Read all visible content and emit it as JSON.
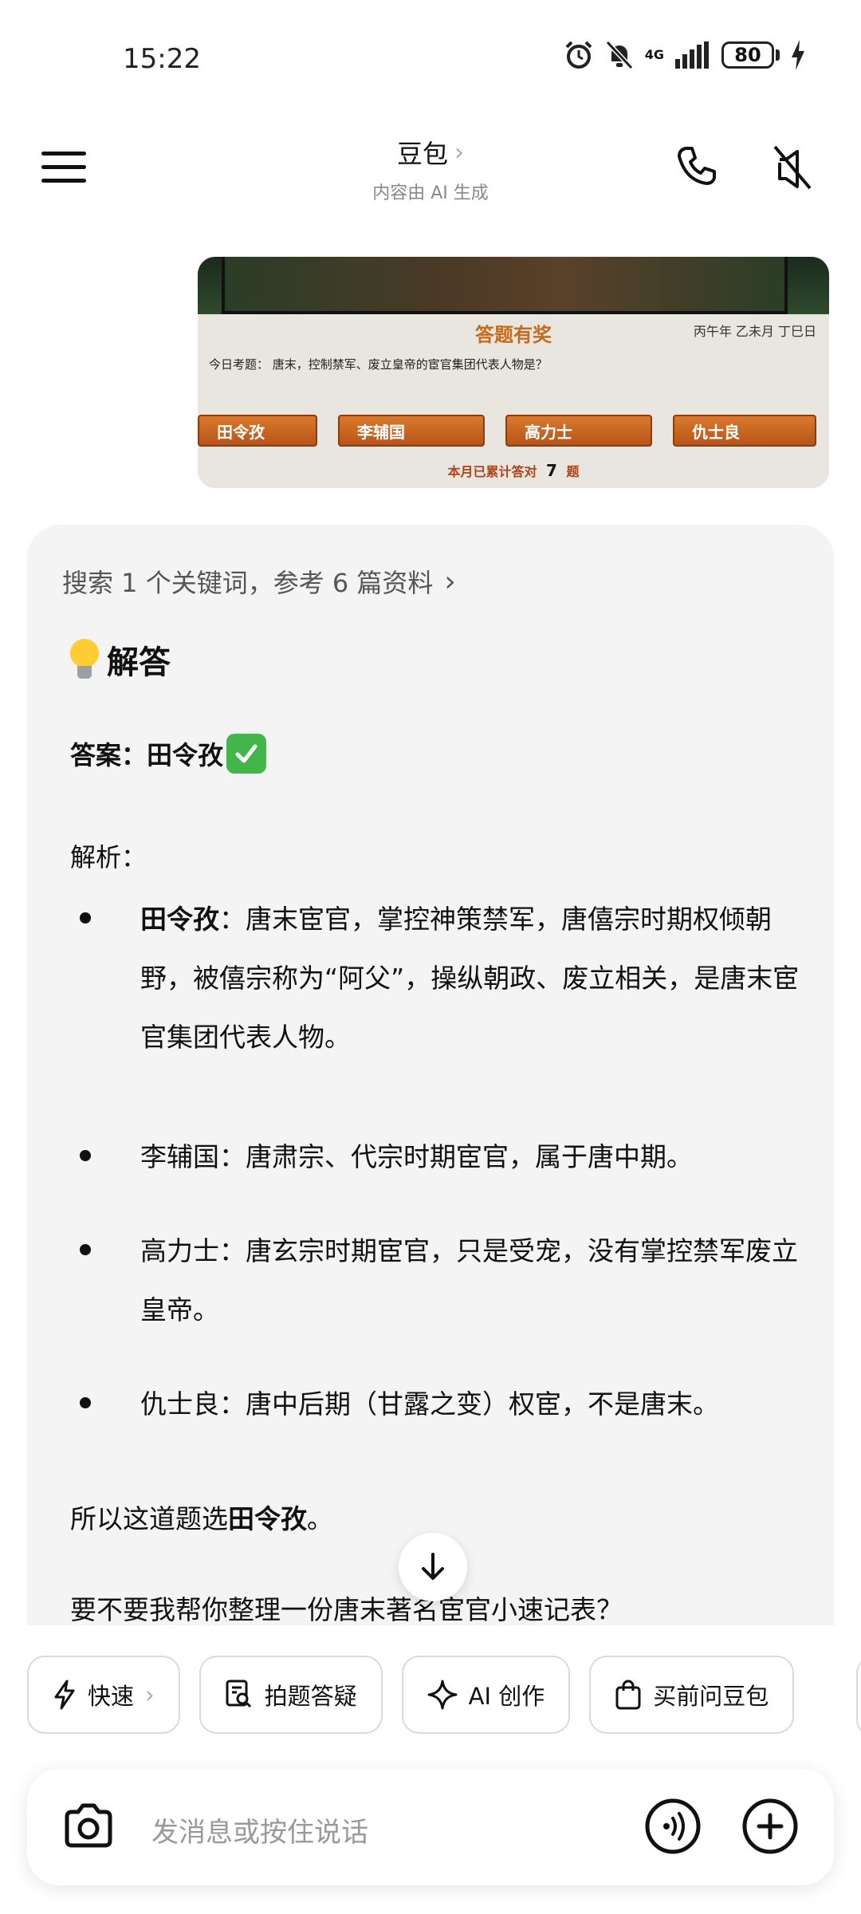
{
  "status_bar": {
    "time": "15:22",
    "network": "4G",
    "battery": "80"
  },
  "header": {
    "title": "豆包",
    "subtitle": "内容由 AI 生成"
  },
  "image_message": {
    "quiz_title": "答题有奖",
    "quiz_date": "丙午年 乙未月 丁巳日",
    "quiz_question": "今日考题： 唐末，控制禁军、废立皇帝的宦官集团代表人物是？",
    "options": [
      "田令孜",
      "李辅国",
      "高力士",
      "仇士良"
    ],
    "quiz_count_prefix": "本月已累计答对",
    "quiz_count_value": "7",
    "quiz_count_suffix": "题"
  },
  "answer": {
    "search_info": "搜索 1 个关键词，参考 6 篇资料",
    "heading": "解答",
    "answer_label": "答案：田令孜",
    "analysis_label": "解析：",
    "bullets": [
      {
        "name": "田令孜",
        "text": "：唐末宦官，掌控神策禁军，唐僖宗时期权倾朝野，被僖宗称为“阿父”，操纵朝政、废立相关，是唐末宦官集团代表人物。"
      },
      {
        "name": "李辅国",
        "text": "：唐肃宗、代宗时期宦官，属于唐中期。"
      },
      {
        "name": "高力士",
        "text": "：唐玄宗时期宦官，只是受宠，没有掌控禁军废立皇帝。"
      },
      {
        "name": "仇士良",
        "text": "：唐中后期（甘露之变）权宦，不是唐末。"
      }
    ],
    "conclusion_prefix": "所以这道题选",
    "conclusion_answer": "田令孜",
    "conclusion_suffix": "。",
    "followup": "要不要我帮你整理一份唐末著名宦官小速记表？"
  },
  "chips": [
    {
      "label": "快速",
      "icon": "lightning-icon"
    },
    {
      "label": "拍题答疑",
      "icon": "photo-search-icon"
    },
    {
      "label": "AI 创作",
      "icon": "sparkle-icon"
    },
    {
      "label": "买前问豆包",
      "icon": "shopping-bag-icon"
    }
  ],
  "input": {
    "placeholder": "发消息或按住说话"
  }
}
